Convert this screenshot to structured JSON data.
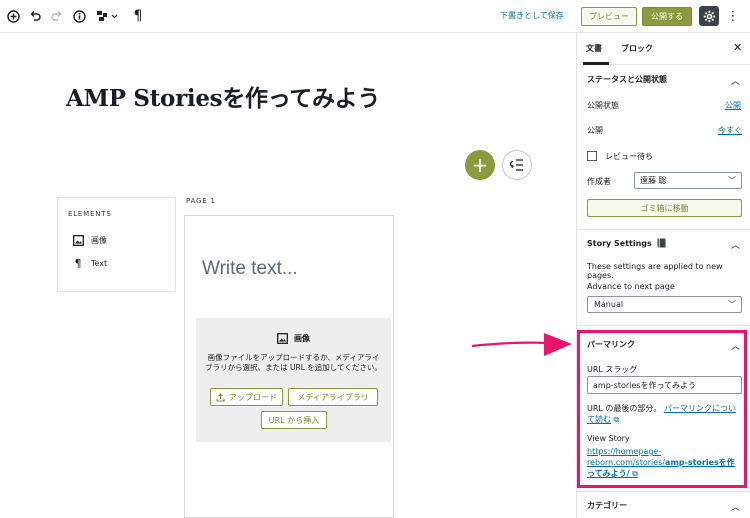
{
  "toolbar": {
    "save_draft": "下書きとして保存",
    "preview": "プレビュー",
    "publish": "公開する"
  },
  "editor": {
    "post_title": "AMP Storiesを作ってみよう",
    "elements_title": "ELEMENTS",
    "elements": [
      {
        "label": "画像",
        "icon": "image-icon"
      },
      {
        "label": "Text",
        "icon": "paragraph-icon"
      }
    ],
    "page_label": "PAGE 1",
    "write_text_placeholder": "Write text...",
    "image_block": {
      "title": "画像",
      "description": "画像ファイルをアップロードするか、メディアライブラリから選択、または URL を追加してください。",
      "upload": "アップロード",
      "media_library": "メディアライブラリ",
      "insert_url": "URL から挿入"
    }
  },
  "sidebar": {
    "tabs": [
      "文書",
      "ブロック"
    ],
    "status": {
      "title": "ステータスと公開状態",
      "visibility_label": "公開状態",
      "visibility_value": "公開",
      "publish_label": "公開",
      "publish_value": "今すぐ",
      "review_label": "レビュー待ち",
      "author_label": "作成者",
      "author_value": "遠藤 聡",
      "trash": "ゴミ箱に移動"
    },
    "story_settings": {
      "title": "Story Settings",
      "description": "These settings are applied to new pages.",
      "advance_label": "Advance to next page",
      "advance_value": "Manual"
    },
    "permalink": {
      "title": "パーマリンク",
      "slug_label": "URL スラッグ",
      "slug_value": "amp-storiesを作ってみよう",
      "help_text": "URL の最後の部分。",
      "help_link": "パーマリンクについて読む",
      "view_story_label": "View Story",
      "view_story_url_plain": "https://homepage-reborn.com/stories/",
      "view_story_url_bold": "amp-storiesを作ってみよう/"
    },
    "categories_title": "カテゴリー"
  },
  "colors": {
    "accent_olive": "#8b9a3e",
    "link_blue": "#0073aa",
    "highlight_pink": "#e8146b"
  }
}
